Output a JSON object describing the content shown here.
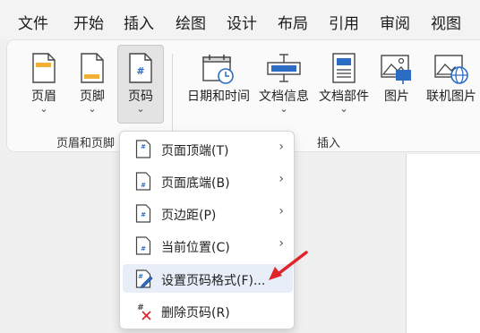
{
  "menubar": {
    "tabs": [
      "文件",
      "开始",
      "插入",
      "绘图",
      "设计",
      "布局",
      "引用",
      "审阅",
      "视图"
    ]
  },
  "ribbon": {
    "header_footer_group": {
      "label": "页眉和页脚",
      "buttons": [
        {
          "label": "页眉",
          "icon": "header-icon"
        },
        {
          "label": "页脚",
          "icon": "footer-icon"
        },
        {
          "label": "页码",
          "icon": "page-number-icon",
          "pressed": true
        }
      ]
    },
    "insert_group": {
      "label": "插入",
      "buttons": [
        {
          "label": "日期和时间",
          "icon": "calendar-clock-icon"
        },
        {
          "label": "文档信息",
          "icon": "document-info-icon"
        },
        {
          "label": "文档部件",
          "icon": "quick-parts-icon"
        },
        {
          "label": "图片",
          "icon": "picture-icon"
        },
        {
          "label": "联机图片",
          "icon": "online-picture-icon"
        }
      ]
    },
    "chevron": "⌄"
  },
  "dropdown": {
    "items": [
      {
        "label": "页面顶端(T)",
        "icon": "top-of-page-icon",
        "submenu": true
      },
      {
        "label": "页面底端(B)",
        "icon": "bottom-of-page-icon",
        "submenu": true
      },
      {
        "label": "页边距(P)",
        "icon": "page-margins-icon",
        "submenu": true
      },
      {
        "label": "当前位置(C)",
        "icon": "current-position-icon",
        "submenu": true
      },
      {
        "label": "设置页码格式(F)...",
        "icon": "format-page-numbers-icon",
        "submenu": false,
        "highlighted": true
      },
      {
        "label": "删除页码(R)",
        "icon": "remove-page-numbers-icon",
        "submenu": false
      }
    ],
    "submenu_arrow": "›"
  },
  "colors": {
    "accent_blue": "#2b6cc4",
    "arrow_red": "#e0242b",
    "highlight": "#e8eef8"
  }
}
